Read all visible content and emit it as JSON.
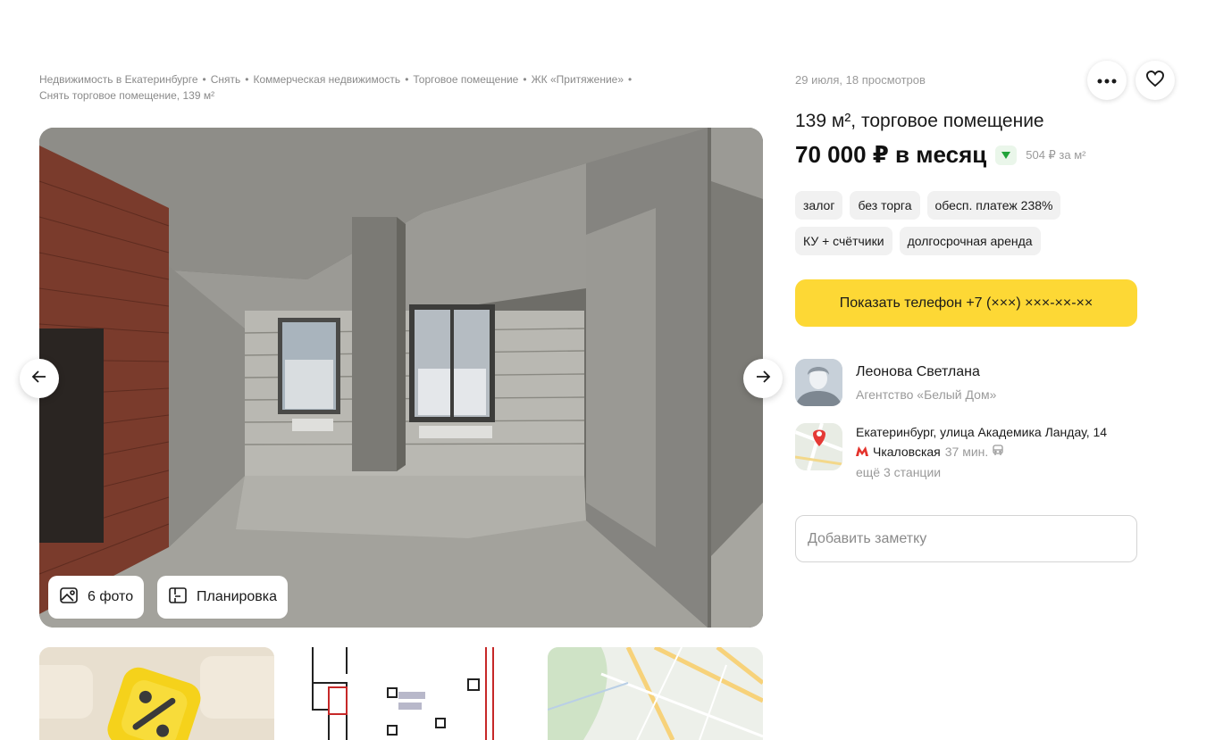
{
  "breadcrumb": {
    "items": [
      "Недвижимость в Екатеринбурге",
      "Снять",
      "Коммерческая недвижимость",
      "Торговое помещение",
      "ЖК «Притяжение»",
      "Снять торговое помещение, 139 м²"
    ],
    "separator": "•"
  },
  "gallery": {
    "photos_label": "6 фото",
    "plan_label": "Планировка"
  },
  "listing": {
    "meta": "29 июля, 18 просмотров",
    "title": "139 м², торговое помещение",
    "price": "70 000 ₽ в месяц",
    "price_per_m": "504 ₽ за м²",
    "tags": [
      "залог",
      "без торга",
      "обесп. платеж 238%",
      "КУ + счётчики",
      "долгосрочная аренда"
    ],
    "phone_button": "Показать телефон +7 (×××) ×××-××-××"
  },
  "agent": {
    "name": "Леонова Светлана",
    "company": "Агентство «Белый Дом»"
  },
  "location": {
    "address": "Екатеринбург, улица Академика Ландау, 14",
    "metro_station": "Чкаловская",
    "metro_time": "37 мин.",
    "more_stations": "ещё 3 станции"
  },
  "note": {
    "placeholder": "Добавить заметку"
  },
  "colors": {
    "accent_yellow": "#fdd835",
    "metro_red": "#e4322b",
    "trend_green": "#22a33a"
  }
}
